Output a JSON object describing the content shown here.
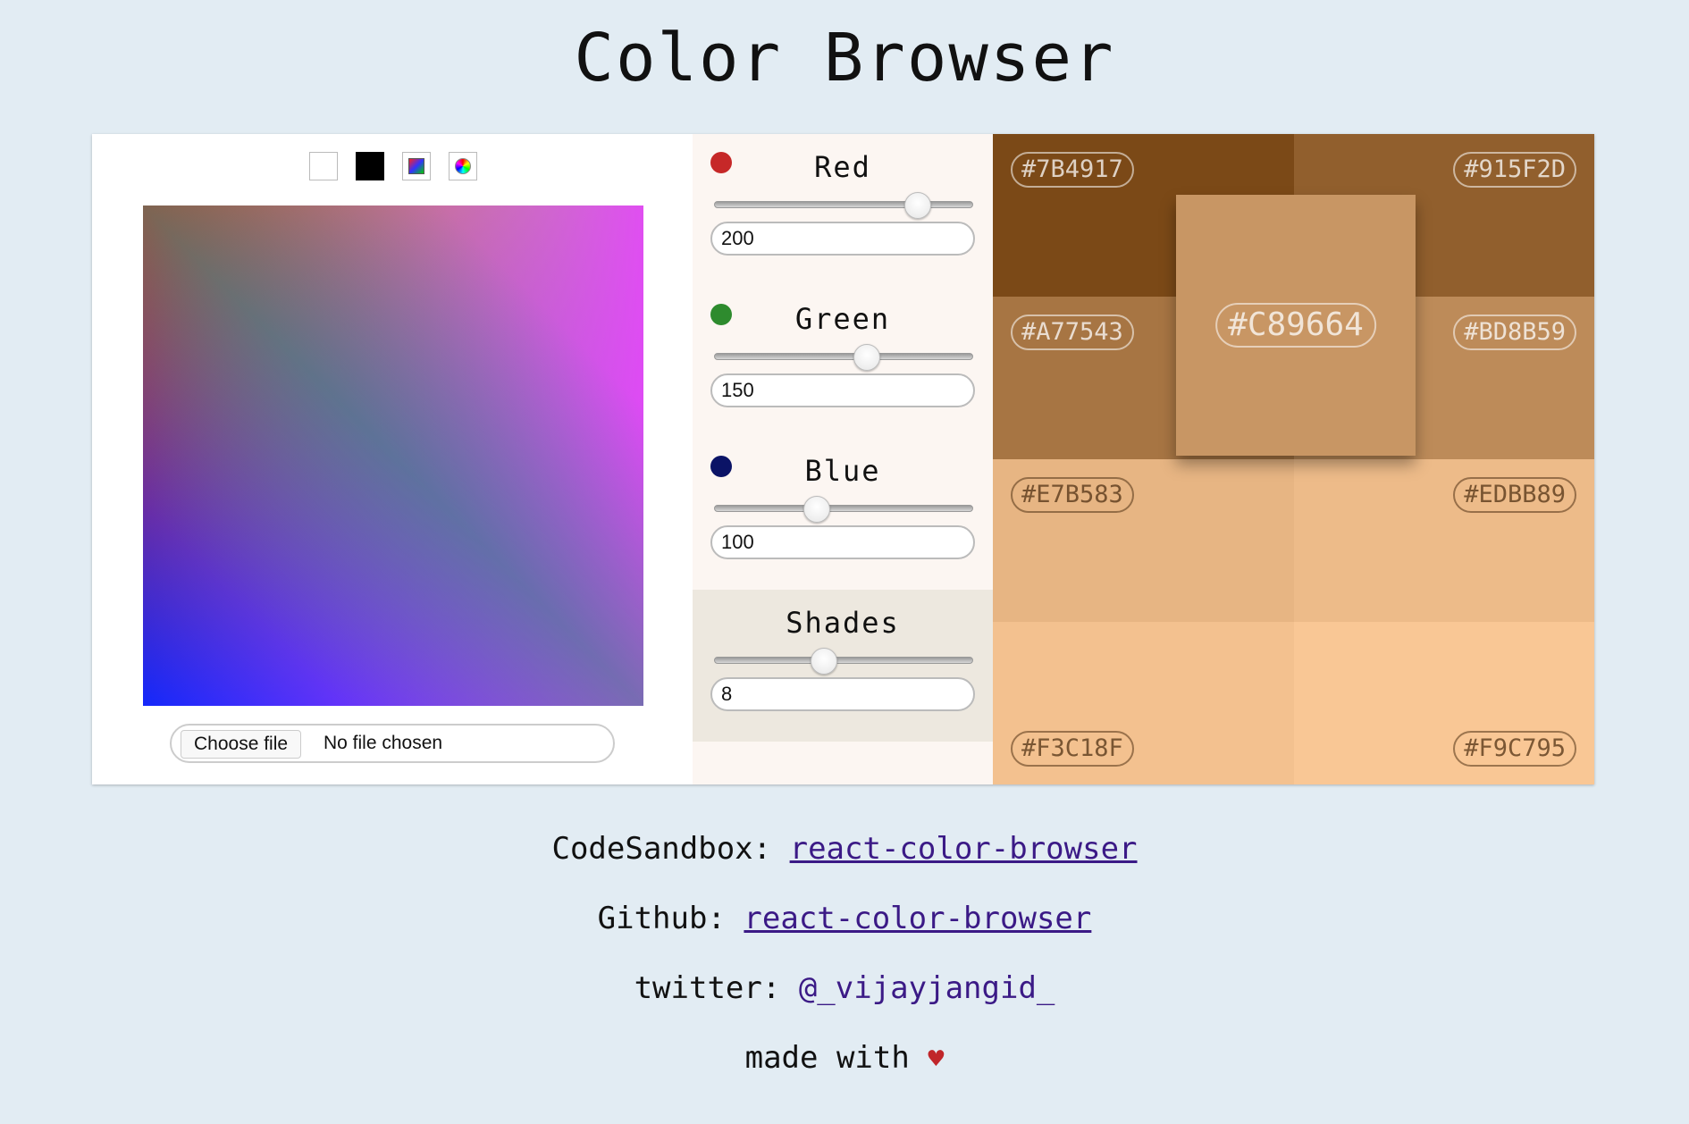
{
  "title": "Color Browser",
  "picker": {
    "modes": [
      "white",
      "black",
      "gradient",
      "wheel"
    ],
    "file_button_label": "Choose file",
    "file_status": "No file chosen"
  },
  "sliders": {
    "red": {
      "label": "Red",
      "value": "200",
      "fraction": 0.784,
      "dot_color": "#c62828"
    },
    "green": {
      "label": "Green",
      "value": "150",
      "fraction": 0.588,
      "dot_color": "#2e8b2e"
    },
    "blue": {
      "label": "Blue",
      "value": "100",
      "fraction": 0.392,
      "dot_color": "#0b1366"
    },
    "shades": {
      "label": "Shades",
      "value": "8",
      "fraction": 0.42
    }
  },
  "palette": {
    "center": {
      "hex": "#C89664",
      "color": "#C89664"
    },
    "tiles": [
      {
        "hex": "#7B4917",
        "color": "#7B4917"
      },
      {
        "hex": "#915F2D",
        "color": "#915F2D"
      },
      {
        "hex": "#A77543",
        "color": "#A77543"
      },
      {
        "hex": "#BD8B59",
        "color": "#BD8B59"
      },
      {
        "hex": "#E7B583",
        "color": "#E7B583"
      },
      {
        "hex": "#EDBB89",
        "color": "#EDBB89"
      },
      {
        "hex": "#F3C18F",
        "color": "#F3C18F"
      },
      {
        "hex": "#F9C795",
        "color": "#F9C795"
      }
    ]
  },
  "footer": {
    "codesandbox_label": "CodeSandbox:",
    "codesandbox_link": "react-color-browser",
    "github_label": "Github:",
    "github_link": "react-color-browser",
    "twitter_label": "twitter:",
    "twitter_link": "@_vijayjangid_",
    "made_with": "made with",
    "heart": "♥"
  }
}
